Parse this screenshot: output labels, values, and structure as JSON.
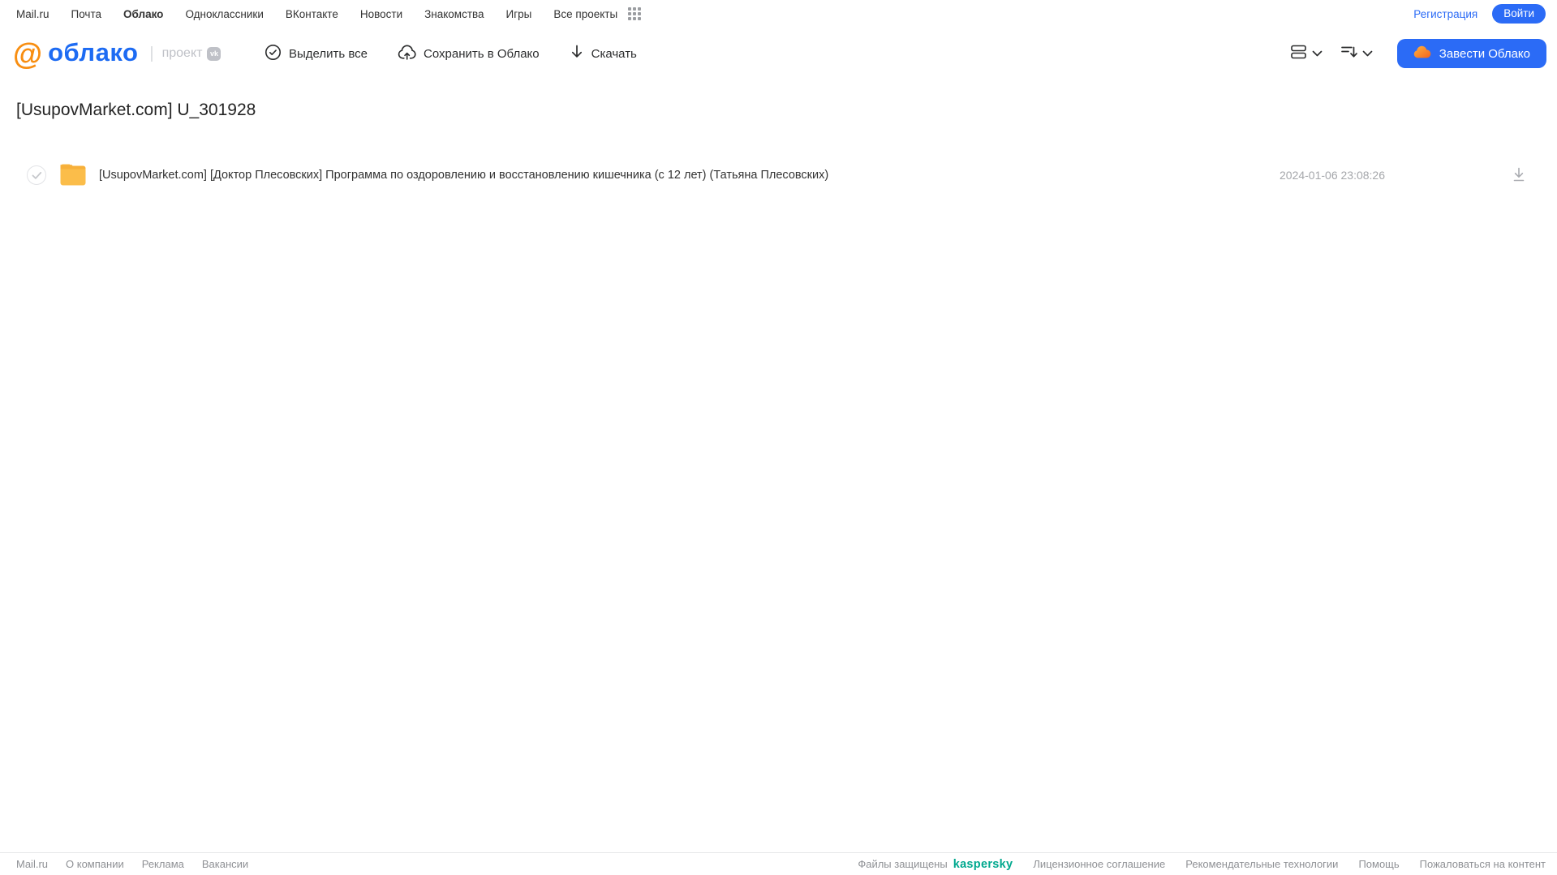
{
  "portal_nav": {
    "items": [
      "Mail.ru",
      "Почта",
      "Облако",
      "Одноклассники",
      "ВКонтакте",
      "Новости",
      "Знакомства",
      "Игры",
      "Все проекты"
    ],
    "active_item": "Облако",
    "registration_label": "Регистрация",
    "login_label": "Войти"
  },
  "header": {
    "logo": {
      "at_symbol": "@",
      "brand": "облако",
      "project_label": "проект",
      "vk_badge": "vk"
    },
    "toolbar": {
      "select_all_label": "Выделить все",
      "save_to_cloud_label": "Сохранить в Облако",
      "download_label": "Скачать"
    },
    "cta_label": "Завести Облако"
  },
  "main": {
    "title": "[UsupovMarket.com] U_301928",
    "files": [
      {
        "type": "folder",
        "name": "[UsupovMarket.com] [Доктор Плесовских] Программа по оздоровлению и восстановлению кишечника (с 12 лет) (Татьяна Плесовских)",
        "date": "2024-01-06 23:08:26"
      }
    ]
  },
  "footer": {
    "left_links": [
      "Mail.ru",
      "О компании",
      "Реклама",
      "Вакансии"
    ],
    "protected_text": "Файлы защищены",
    "kaspersky_label": "kaspersky",
    "right_links": [
      "Лицензионное соглашение",
      "Рекомендательные технологии",
      "Помощь",
      "Пожаловаться на контент"
    ]
  },
  "colors": {
    "accent_blue": "#2b6bf6",
    "brand_orange": "#f88e11",
    "folder_yellow": "#fbbd4a",
    "kaspersky_green": "#00a88e"
  }
}
